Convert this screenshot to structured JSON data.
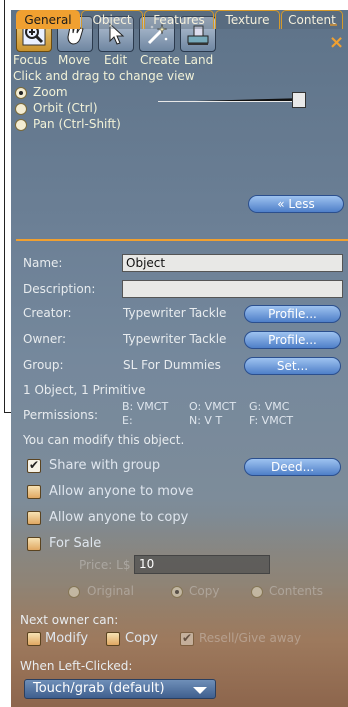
{
  "tools": [
    {
      "label": "Focus",
      "icon": "magnifier-icon"
    },
    {
      "label": "Move",
      "icon": "hand-icon"
    },
    {
      "label": "Edit",
      "icon": "cursor-icon"
    },
    {
      "label": "Create",
      "icon": "magic-wand-icon"
    },
    {
      "label": "Land",
      "icon": "bulldozer-icon"
    }
  ],
  "close_label": "–×",
  "hint": "Click and drag to change view",
  "view_modes": [
    "Zoom",
    "Orbit (Ctrl)",
    "Pan (Ctrl-Shift)"
  ],
  "zoom_level": 0.95,
  "less_button": "« Less",
  "tabs": [
    "General",
    "Object",
    "Features",
    "Texture",
    "Content"
  ],
  "general": {
    "name_label": "Name:",
    "name_value": "Object",
    "description_label": "Description:",
    "description_value": "",
    "creator_label": "Creator:",
    "creator_value": "Typewriter Tackle",
    "owner_label": "Owner:",
    "owner_value": "Typewriter Tackle",
    "group_label": "Group:",
    "group_value": "SL For Dummies",
    "profile_button": "Profile...",
    "set_button": "Set...",
    "count_text": "1 Object, 1 Primitive",
    "permissions_label": "Permissions:",
    "perm_b": "B: VMCT",
    "perm_o": "O: VMCT",
    "perm_g": "G: VMC",
    "perm_e": "E:",
    "perm_n": "N: V  T",
    "perm_f": "F: VMCT",
    "modify_text": "You can modify this object.",
    "share_with_group": "Share with group",
    "deed_button": "Deed...",
    "allow_move": "Allow anyone to move",
    "allow_copy": "Allow anyone to copy",
    "for_sale": "For Sale",
    "price_label": "Price: L$",
    "price_value": "10",
    "sale_types": [
      "Original",
      "Copy",
      "Contents"
    ],
    "next_owner_label": "Next owner can:",
    "next_modify": "Modify",
    "next_copy": "Copy",
    "next_resell": "Resell/Give away",
    "left_click_label": "When Left-Clicked:",
    "left_click_value": "Touch/grab (default)"
  },
  "colors": {
    "accent": "#f0a030",
    "button_blue": "#4f7fc8"
  }
}
